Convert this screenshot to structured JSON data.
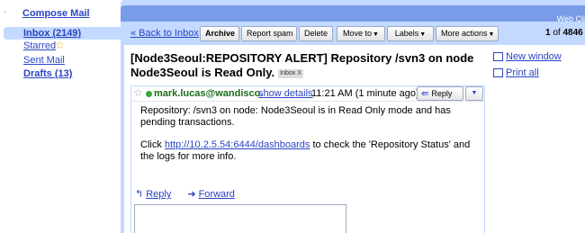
{
  "nav": {
    "compose_label": "Compose Mail",
    "inbox_label": "Inbox (2149)",
    "starred_label": "Starred",
    "sent_label": "Sent Mail",
    "drafts_label": "Drafts (13)"
  },
  "header": {
    "webclip_text": "Web Cli"
  },
  "toolbar": {
    "back_label": "« Back to Inbox",
    "archive_label": "Archive",
    "report_spam_label": "Report spam",
    "delete_label": "Delete",
    "move_to_label": "Move to",
    "labels_label": "Labels",
    "more_actions_label": "More actions",
    "paging_current": "1",
    "paging_of": "of",
    "paging_total": "4846"
  },
  "message": {
    "subject": "[Node3Seoul:REPOSITORY ALERT] Repository /svn3 on node Node3Seoul is Read Only.",
    "label_tag": "Inbox",
    "label_remove": "X",
    "sender": "mark.lucas@wandisco.",
    "show_details": "show details",
    "time": "11:21 AM (1 minute ago)",
    "reply_button": "Reply",
    "body_line1": "Repository: /svn3 on node: Node3Seoul is in Read Only mode and has pending transactions.",
    "body_click": "Click",
    "body_link": "http://10.2.5.54:6444/dashboards",
    "body_rest": "to check the 'Repository Status' and the logs for more info."
  },
  "side_tools": {
    "new_window": "New window",
    "print_all": "Print all"
  },
  "reply_actions": {
    "reply": "Reply",
    "forward": "Forward"
  },
  "colors": {
    "accent": "#c3d9ff",
    "header_strip": "#7a9ce8",
    "link": "#2a44c4",
    "sender": "#196d19",
    "online": "#3aa53a"
  },
  "icons": {
    "starred": "star-icon",
    "online": "online-status-icon",
    "reply": "reply-arrow-icon",
    "forward": "forward-arrow-icon",
    "new_window": "new-window-icon",
    "print": "print-icon"
  }
}
